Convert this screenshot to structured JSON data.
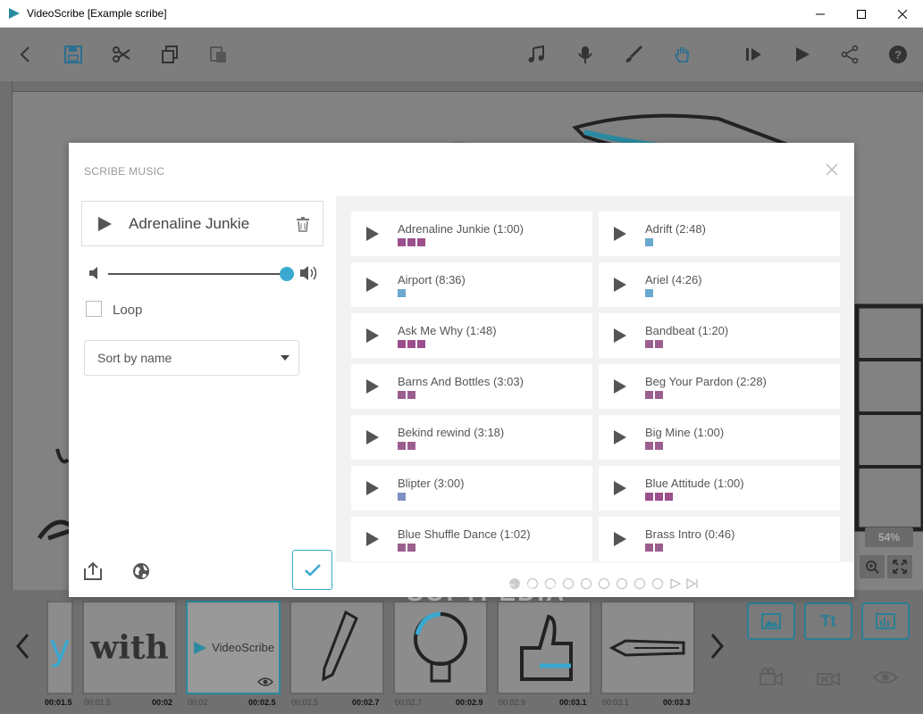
{
  "window": {
    "title": "VideoScribe [Example scribe]"
  },
  "modal": {
    "title": "SCRIBE MUSIC",
    "now_playing": "Adrenaline Junkie",
    "volume_level": 1.0,
    "loop_label": "Loop",
    "loop_checked": false,
    "sort_label": "Sort by name",
    "tracks": [
      {
        "name": "Adrenaline Junkie (1:00)",
        "bars": 3,
        "color": "#9b4f8c"
      },
      {
        "name": "Adrift (2:48)",
        "bars": 1,
        "color": "#6aa8d0"
      },
      {
        "name": "Airport (8:36)",
        "bars": 1,
        "color": "#6aa8d0"
      },
      {
        "name": "Ariel (4:26)",
        "bars": 1,
        "color": "#6aa8d0"
      },
      {
        "name": "Ask Me Why (1:48)",
        "bars": 3,
        "color": "#9b4f8c"
      },
      {
        "name": "Bandbeat (1:20)",
        "bars": 2,
        "color": "#9b5f8f"
      },
      {
        "name": "Barns And Bottles (3:03)",
        "bars": 2,
        "color": "#9b5f8f"
      },
      {
        "name": "Beg Your Pardon (2:28)",
        "bars": 2,
        "color": "#9b5f8f"
      },
      {
        "name": "Bekind rewind (3:18)",
        "bars": 2,
        "color": "#9b5f8f"
      },
      {
        "name": "Big Mine (1:00)",
        "bars": 2,
        "color": "#9b5f8f"
      },
      {
        "name": "Blipter (3:00)",
        "bars": 1,
        "color": "#7f8fbf"
      },
      {
        "name": "Blue Attitude (1:00)",
        "bars": 3,
        "color": "#9b4f8c"
      },
      {
        "name": "Blue Shuffle Dance (1:02)",
        "bars": 2,
        "color": "#9b5f8f"
      },
      {
        "name": "Brass Intro (0:46)",
        "bars": 2,
        "color": "#9b5f8f"
      }
    ],
    "pages": 9,
    "active_page": 1
  },
  "canvas": {
    "zoom": "54%"
  },
  "timeline": {
    "frames": [
      {
        "label": "y",
        "start": "",
        "end": "00:01.5"
      },
      {
        "label": "with",
        "start": "00:01.5",
        "end": "00:02"
      },
      {
        "label": "VideoScribe",
        "start": "00:02",
        "end": "00:02.5"
      },
      {
        "label": "",
        "start": "00:02.5",
        "end": "00:02.7"
      },
      {
        "label": "",
        "start": "00:02.7",
        "end": "00:02.9"
      },
      {
        "label": "",
        "start": "00:02.9",
        "end": "00:03.1"
      },
      {
        "label": "",
        "start": "00:03.1",
        "end": "00:03.3"
      }
    ],
    "text_button": "Tt"
  },
  "watermark": "SOFTPEDIA",
  "colors": {
    "accent": "#3aa9d0",
    "modal_bg": "#ffffff",
    "toolbar_bg": "#7d7d7d"
  }
}
